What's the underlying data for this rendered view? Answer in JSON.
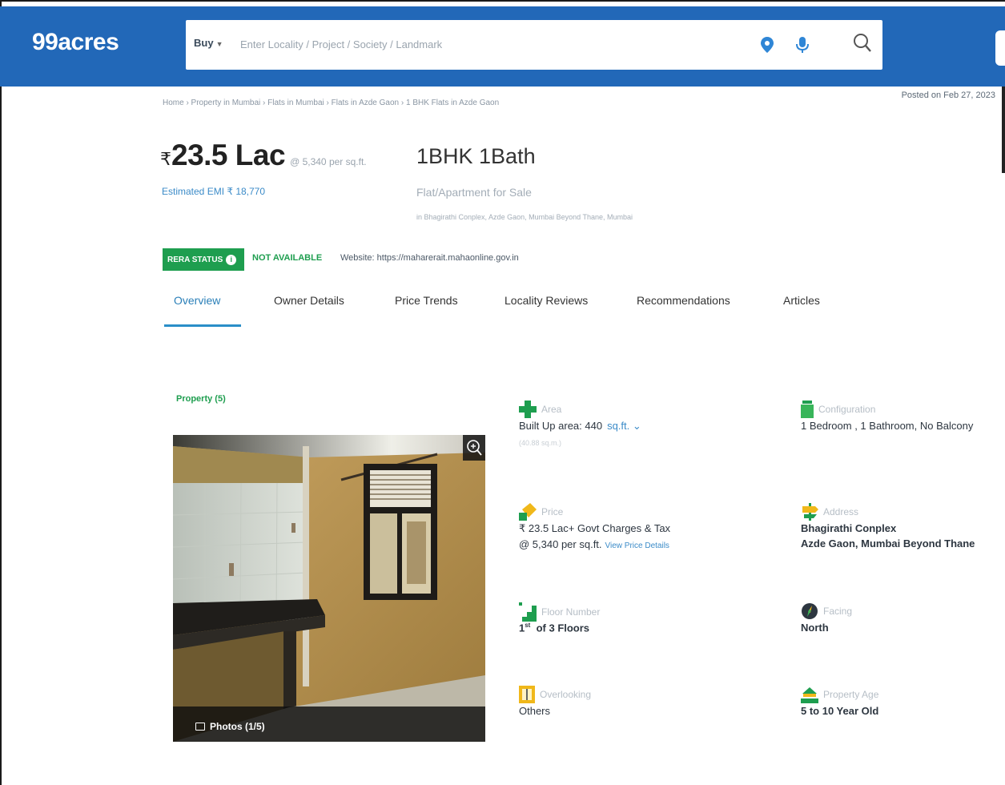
{
  "header": {
    "logo": "99acres",
    "buy_label": "Buy",
    "search_placeholder": "Enter Locality / Project / Society / Landmark"
  },
  "breadcrumb": "Home › Property in Mumbai › Flats in Mumbai › Flats in Azde Gaon › 1 BHK Flats in Azde Gaon",
  "posted_on": "Posted on Feb 27, 2023",
  "listing": {
    "currency_symbol": "₹",
    "price": "23.5 Lac",
    "per_sqft": "@ 5,340 per sq.ft.",
    "emi": "Estimated EMI ₹ 18,770",
    "config": "1BHK 1Bath",
    "type": "Flat/Apartment for Sale",
    "location": "in Bhagirathi Conplex, Azde Gaon, Mumbai Beyond Thane, Mumbai"
  },
  "rera": {
    "badge": "RERA STATUS",
    "status": "NOT AVAILABLE",
    "website": "Website: https://maharerait.mahaonline.gov.in"
  },
  "tabs": [
    "Overview",
    "Owner Details",
    "Price Trends",
    "Locality Reviews",
    "Recommendations",
    "Articles"
  ],
  "property_label": "Property (5)",
  "photos_label": "Photos (1/5)",
  "details": {
    "area": {
      "label": "Area",
      "value": "Built Up area: 440",
      "unit": "sq.ft.",
      "sub": "(40.88 sq.m.)"
    },
    "configuration": {
      "label": "Configuration",
      "value": "1 Bedroom , 1 Bathroom, No Balcony"
    },
    "price": {
      "label": "Price",
      "value": "₹ 23.5 Lac+ Govt Charges & Tax",
      "sub": "@ 5,340 per sq.ft.",
      "link": "View Price Details"
    },
    "address": {
      "label": "Address",
      "value": "Bhagirathi Conplex",
      "sub": "Azde Gaon, Mumbai Beyond Thane"
    },
    "floor": {
      "label": "Floor Number",
      "value_ordinal": "1",
      "value_sup": "st",
      "value_rest": "of 3 Floors"
    },
    "facing": {
      "label": "Facing",
      "value": "North"
    },
    "overlooking": {
      "label": "Overlooking",
      "value": "Others"
    },
    "age": {
      "label": "Property Age",
      "value": "5 to 10 Year Old"
    }
  },
  "colors": {
    "header_blue": "#2268b8",
    "rera_green": "#1e9e4f",
    "link_blue": "#3b8bc8",
    "tab_active": "#2a7fb8"
  }
}
